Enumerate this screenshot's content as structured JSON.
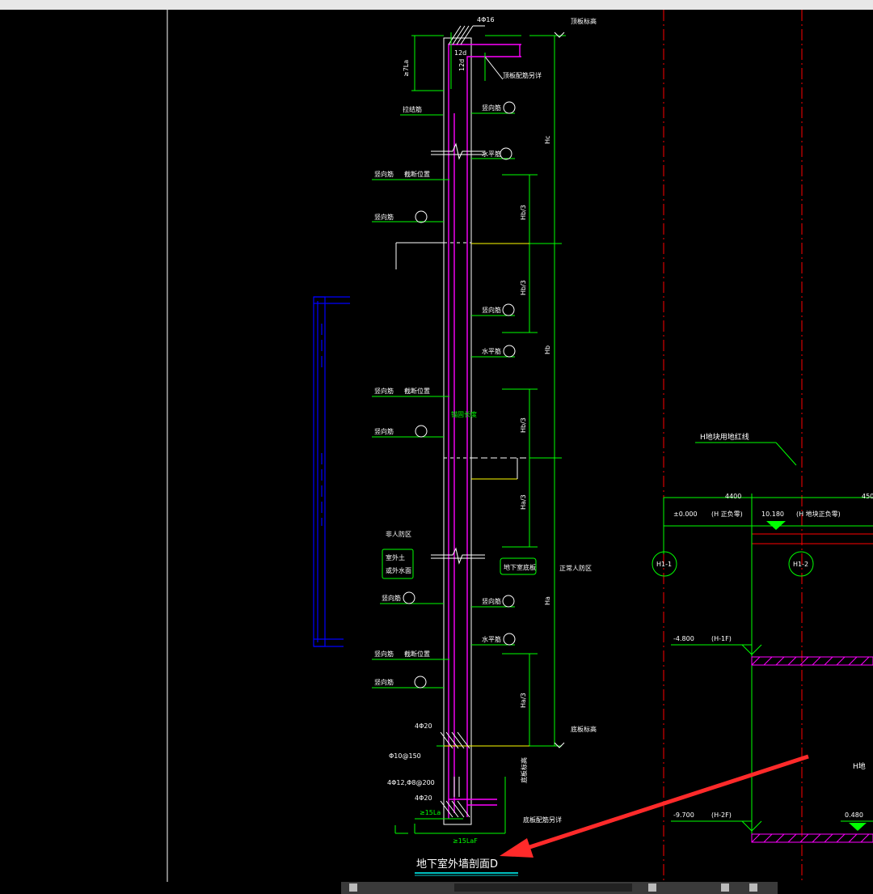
{
  "labels": {
    "top_rebar": "4Φ16",
    "top_level": "顶板标高",
    "anchor_la": "≥7La",
    "d12_a": "12d",
    "d12_b": "12d",
    "top_slab_rebar": "顶板配筋另详",
    "tie_bar": "拉结筋",
    "vert_1": "竖向筋",
    "horiz_1": "水平筋",
    "vert_cut_a": "竖向筋",
    "cut_pos_a": "截断位置",
    "vert_2": "竖向筋",
    "hc": "Hc",
    "hb3_a": "Hb/3",
    "hb3_b": "Hb/3",
    "hb3_c": "Hb/3",
    "hb": "Hb",
    "vert_3": "竖向筋",
    "horiz_2": "水平筋",
    "vert_cut_b": "竖向筋",
    "cut_pos_b": "截断位置",
    "vert_4": "竖向筋",
    "anchor_note": "锚固长度",
    "ha3_a": "Ha/3",
    "non_defense": "非人防区",
    "outdoor_1": "室外土",
    "outdoor_2": "或外水面",
    "basement_plate": "地下室底板",
    "defense": "正常人防区",
    "ha": "Ha",
    "vert_5": "竖向筋",
    "vert_6": "竖向筋",
    "horiz_3": "水平筋",
    "vert_cut_c": "竖向筋",
    "cut_pos_c": "截断位置",
    "vert_7": "竖向筋",
    "ha3_b": "Ha/3",
    "bottom_rebar_a": "4Φ20",
    "bottom_level": "底板标高",
    "stirrup": "Φ10@150",
    "bars_mid": "4Φ12,Φ8@200",
    "bottom_rebar_b": "4Φ20",
    "anchor_15a": "≥15La",
    "anchor_15b": "≥15LaF",
    "bottom_slab_rebar": "底板配筋另详",
    "section_title": "地下室外墙剖面D",
    "redline": "H地块用地红线",
    "dim_4400": "4400",
    "dim_450": "450",
    "elev_0": "±0.000",
    "elev_0_note": "(H 正负零)",
    "elev_10180": "10.180",
    "elev_10180_note": "(H 地块正负零)",
    "axis_1": "H1-1",
    "axis_2": "H1-2",
    "elev_m4800": "-4.800",
    "elev_m4800_note": "(H-1F)",
    "h_plot": "H地",
    "elev_m9700": "-9.700",
    "elev_m9700_note": "(H-2F)",
    "elev_0480": "0.480"
  },
  "colors": {
    "green": "#00ff00",
    "magenta": "#ff00ff",
    "white": "#ffffff",
    "yellow": "#ffff00",
    "red": "#ff0000",
    "blue": "#0000ff",
    "annotation_arrow": "#ff2a2a"
  }
}
